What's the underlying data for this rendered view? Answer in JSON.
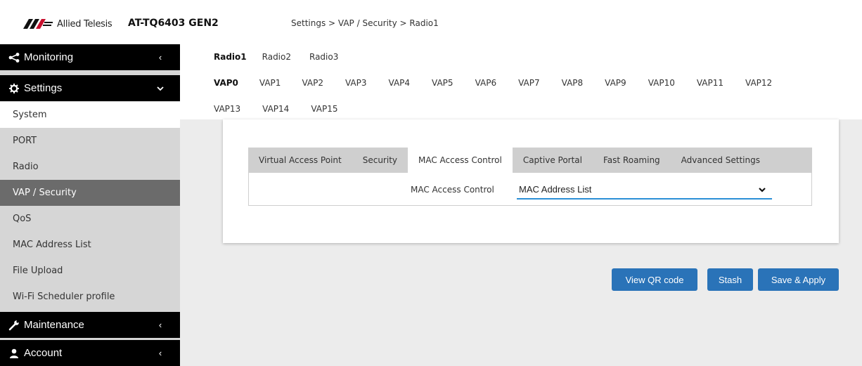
{
  "header": {
    "brand": "Allied Telesis",
    "device_name": "AT-TQ6403 GEN2",
    "breadcrumb": "Settings > VAP / Security > Radio1"
  },
  "sidebar": {
    "monitoring": {
      "label": "Monitoring",
      "icon": "share-icon",
      "chevron": "‹"
    },
    "settings": {
      "label": "Settings",
      "icon": "gear-icon",
      "chevron": "⌄"
    },
    "items": [
      {
        "label": "System"
      },
      {
        "label": "PORT"
      },
      {
        "label": "Radio"
      },
      {
        "label": "VAP / Security"
      },
      {
        "label": "QoS"
      },
      {
        "label": "MAC Address List"
      },
      {
        "label": "File Upload"
      },
      {
        "label": "Wi-Fi Scheduler profile"
      }
    ],
    "maintenance": {
      "label": "Maintenance",
      "icon": "wrench-icon",
      "chevron": "‹"
    },
    "account": {
      "label": "Account",
      "icon": "user-icon",
      "chevron": "‹"
    }
  },
  "radio_tabs": [
    "Radio1",
    "Radio2",
    "Radio3"
  ],
  "vap_tabs": [
    "VAP0",
    "VAP1",
    "VAP2",
    "VAP3",
    "VAP4",
    "VAP5",
    "VAP6",
    "VAP7",
    "VAP8",
    "VAP9",
    "VAP10",
    "VAP11",
    "VAP12",
    "VAP13",
    "VAP14",
    "VAP15"
  ],
  "inner_tabs": [
    "Virtual Access Point",
    "Security",
    "MAC Access Control",
    "Captive Portal",
    "Fast Roaming",
    "Advanced Settings"
  ],
  "mac_access": {
    "label": "MAC Access Control",
    "value": "MAC Address List"
  },
  "buttons": {
    "qr": "View QR code",
    "stash": "Stash",
    "save": "Save & Apply"
  },
  "colors": {
    "accent": "#2a73b8",
    "active_sidebar": "#6b6b6b",
    "select_underline": "#2b8fd6"
  }
}
